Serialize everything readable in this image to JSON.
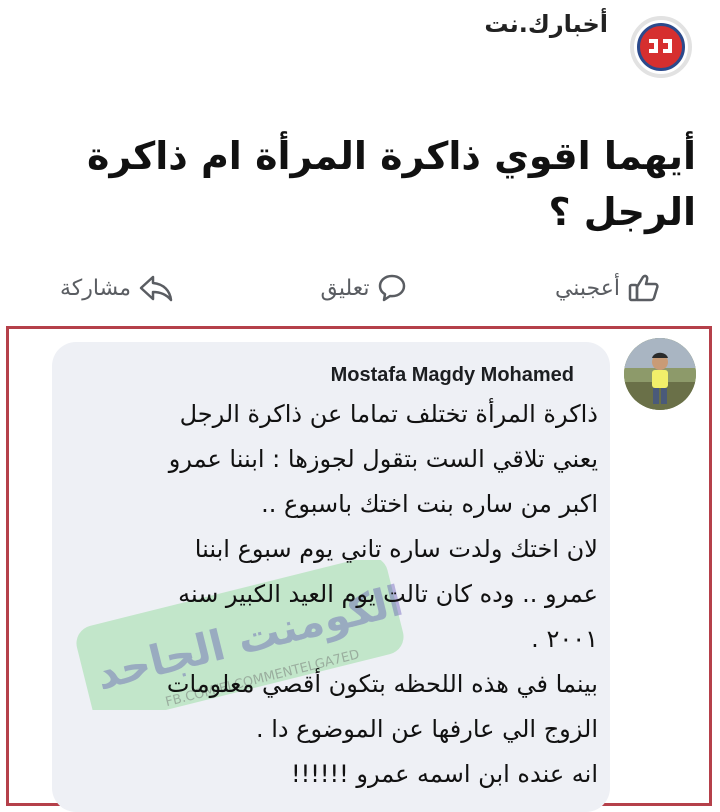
{
  "page": {
    "name": "أخبارك.نت",
    "logo_text": "دد"
  },
  "post": {
    "title": "أيهما اقوي ذاكرة المرأة ام ذاكرة الرجل ؟"
  },
  "actions": {
    "like": "أعجبني",
    "comment": "تعليق",
    "share": "مشاركة"
  },
  "comment": {
    "author": "Mostafa Magdy Mohamed",
    "lines": [
      "ذاكرة المرأة تختلف تماما عن ذاكرة الرجل",
      "يعني تلاقي الست بتقول لجوزها : ابننا عمرو",
      "اكبر من ساره بنت اختك باسبوع ..",
      "لان اختك ولدت ساره تاني يوم سبوع ابننا",
      "عمرو .. وده كان تالت يوم العيد الكبير سنه",
      "٢٠٠١ .",
      "بينما في هذه اللحظه بتكون أقصي معلومات",
      "الزوج الي عارفها عن الموضوع دا .",
      "انه عنده ابن اسمه عمرو !!!!!!"
    ]
  },
  "watermark": {
    "main_text": "الكومنت الجاحد",
    "url": "FB.COM/ELCOMMENTELGA7ED"
  },
  "colors": {
    "accent_red": "#d62f2f",
    "logo_ring": "#2b4a8c",
    "frame_border": "#b5404a",
    "bubble_bg": "#eef0f5",
    "action_text": "#5a5d62"
  }
}
